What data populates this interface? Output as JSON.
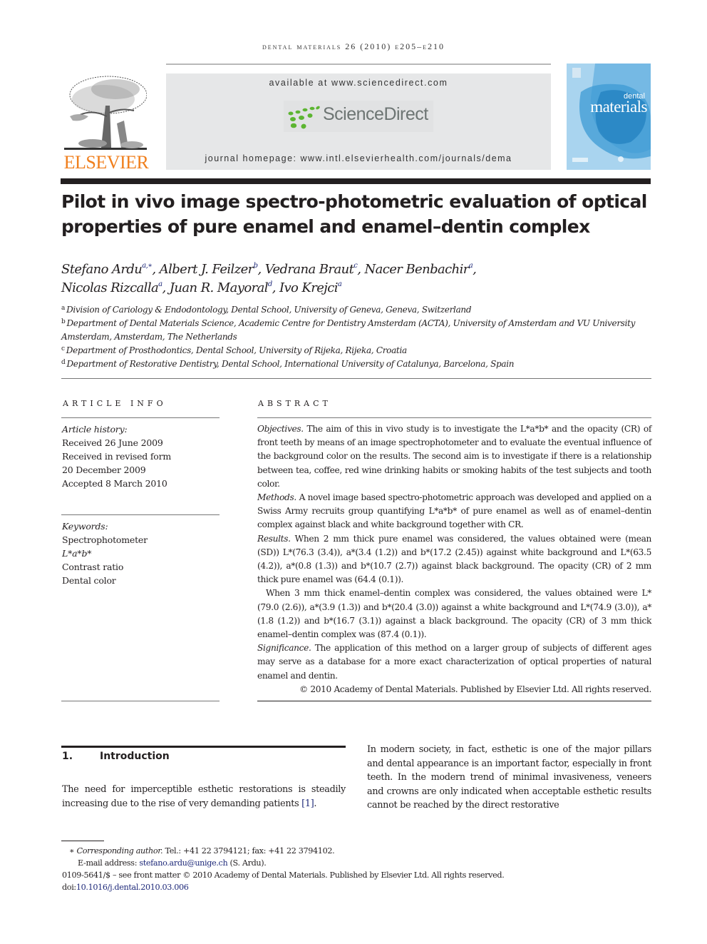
{
  "running_head": "dental materials 26 (2010) e205–e210",
  "masthead": {
    "publisher_logo_text": "ELSEVIER",
    "available_at": "available at www.sciencedirect.com",
    "sciencedirect_logo_text": "ScienceDirect",
    "journal_homepage": "journal homepage: www.intl.elsevierhealth.com/journals/dema",
    "cover": {
      "title_small": "dental",
      "title_big": "materials"
    },
    "colors": {
      "elsevier_orange": "#f07f1d",
      "sciencedirect_green": "#5cb531",
      "sciencedirect_gray": "#6d7573",
      "cover_blue": "#8fc6e8",
      "link_blue": "#1f2a7a"
    }
  },
  "article": {
    "title_line1": "Pilot in vivo image spectro-photometric evaluation of optical",
    "title_line2": "properties of pure enamel and enamel–dentin complex",
    "authors": [
      {
        "name": "Stefano Ardu",
        "sup": "a,∗",
        "sep": ", "
      },
      {
        "name": "Albert J. Feilzer",
        "sup": "b",
        "sep": ", "
      },
      {
        "name": "Vedrana Braut",
        "sup": "c",
        "sep": ", "
      },
      {
        "name": "Nacer Benbachir",
        "sup": "a",
        "sep": ","
      },
      {
        "name": "Nicolas Rizcalla",
        "sup": "a",
        "sep": ", "
      },
      {
        "name": "Juan R. Mayoral",
        "sup": "d",
        "sep": ", "
      },
      {
        "name": "Ivo Krejci",
        "sup": "a",
        "sep": ""
      }
    ],
    "affiliations": [
      {
        "key": "a",
        "text": "Division of Cariology & Endodontology, Dental School, University of Geneva, Geneva, Switzerland"
      },
      {
        "key": "b",
        "text": "Department of Dental Materials Science, Academic Centre for Dentistry Amsterdam (ACTA), University of Amsterdam and VU University Amsterdam, Amsterdam, The Netherlands"
      },
      {
        "key": "c",
        "text": "Department of Prosthodontics, Dental School, University of Rijeka, Rijeka, Croatia"
      },
      {
        "key": "d",
        "text": "Department of Restorative Dentistry, Dental School, International University of Catalunya, Barcelona, Spain"
      }
    ]
  },
  "article_info": {
    "heading": "ARTICLE INFO",
    "history_label": "Article history:",
    "history": [
      "Received 26 June 2009",
      "Received in revised form",
      "20 December 2009",
      "Accepted 8 March 2010"
    ],
    "keywords_label": "Keywords:",
    "keywords": [
      "Spectrophotometer",
      "L*a*b*",
      "Contrast ratio",
      "Dental color"
    ]
  },
  "abstract": {
    "heading": "ABSTRACT",
    "objectives_label": "Objectives.",
    "objectives_text": " The aim of this in vivo study is to investigate the L*a*b* and the opacity (CR) of front teeth by means of an image spectrophotometer and to evaluate the eventual influence of the background color on the results. The second aim is to investigate if there is a relationship between tea, coffee, red wine drinking habits or smoking habits of the test subjects and tooth color.",
    "methods_label": "Methods.",
    "methods_text": " A novel image based spectro-photometric approach was developed and applied on a Swiss Army recruits group quantifying L*a*b* of pure enamel as well as of enamel–dentin complex against black and white background together with CR.",
    "results_label": "Results.",
    "results_text": " When 2 mm thick pure enamel was considered, the values obtained were (mean (SD)) L*(76.3 (3.4)), a*(3.4 (1.2)) and b*(17.2 (2.45)) against white background and L*(63.5 (4.2)), a*(0.8 (1.3)) and b*(10.7 (2.7)) against black background. The opacity (CR) of 2 mm thick pure enamel was (64.4 (0.1)).",
    "results_text2": "When 3 mm thick enamel–dentin complex was considered, the values obtained were L*(79.0 (2.6)), a*(3.9 (1.3)) and b*(20.4 (3.0)) against a white background and L*(74.9 (3.0)), a*(1.8 (1.2)) and b*(16.7 (3.1)) against a black background. The opacity (CR) of 3 mm thick enamel–dentin complex was (87.4 (0.1)).",
    "significance_label": "Significance.",
    "significance_text": " The application of this method on a larger group of subjects of different ages may serve as a database for a more exact characterization of optical properties of natural enamel and dentin.",
    "copyright": "© 2010 Academy of Dental Materials. Published by Elsevier Ltd. All rights reserved."
  },
  "introduction": {
    "number": "1.",
    "heading": "Introduction",
    "left_text": "The need for imperceptible esthetic restorations is steadily increasing due to the rise of very demanding patients ",
    "left_ref": "[1]",
    "left_tail": ".",
    "right_text": "In modern society, in fact, esthetic is one of the major pillars and dental appearance is an important factor, especially in front teeth. In the modern trend of minimal invasiveness, veneers and crowns are only indicated when acceptable esthetic results cannot be reached by the direct restorative"
  },
  "footnotes": {
    "star": "∗",
    "corresponding_label": "Corresponding author.",
    "contact": " Tel.: +41 22 3794121; fax: +41 22 3794102.",
    "email_label": "E-mail address: ",
    "email": "stefano.ardu@unige.ch",
    "email_tail": " (S. Ardu).",
    "front_matter": "0109-5641/$ – see front matter © 2010 Academy of Dental Materials. Published by Elsevier Ltd. All rights reserved.",
    "doi_label": "doi:",
    "doi": "10.1016/j.dental.2010.03.006"
  }
}
